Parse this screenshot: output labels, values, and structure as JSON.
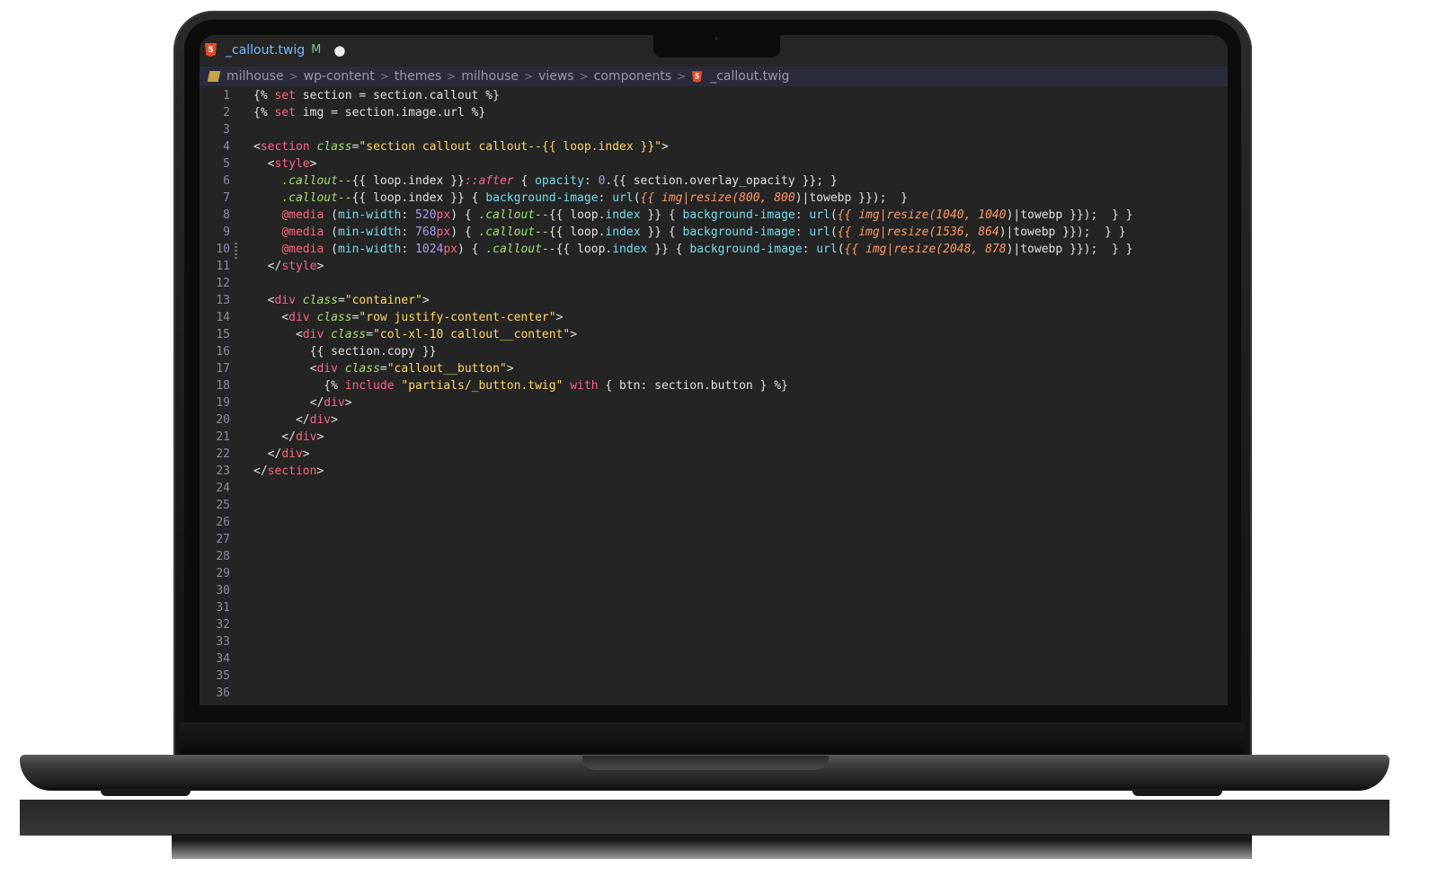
{
  "editor": {
    "tab": {
      "icon": "html5-icon",
      "filename": "_callout.twig",
      "status": "M",
      "dirty_dot": "●"
    },
    "breadcrumb": [
      "milhouse",
      "wp-content",
      "themes",
      "milhouse",
      "views",
      "components",
      "_callout.twig"
    ],
    "line_numbers": [
      "1",
      "2",
      "3",
      "4",
      "5",
      "6",
      "7",
      "8",
      "9",
      "10",
      "11",
      "12",
      "13",
      "14",
      "15",
      "16",
      "17",
      "18",
      "19",
      "20",
      "21",
      "22",
      "23",
      "24",
      "25",
      "26",
      "27",
      "28",
      "29",
      "30",
      "31",
      "32",
      "33",
      "34",
      "35",
      "36"
    ],
    "colors": {
      "background": "#242424",
      "keyword": "#ff6188",
      "string": "#ffd866",
      "attribute": "#a9dc76",
      "property": "#78dce8",
      "number": "#ab9df2",
      "italic_arg": "#fc9867"
    }
  },
  "code": {
    "l1": [
      [
        "{% ",
        "k-pun"
      ],
      [
        "set",
        "k-twig"
      ],
      [
        " section = section.callout %}",
        "k-pun"
      ]
    ],
    "l2": [
      [
        "{% ",
        "k-pun"
      ],
      [
        "set",
        "k-twig"
      ],
      [
        " img = section.image.url %}",
        "k-pun"
      ]
    ],
    "l3": [],
    "l4": [
      [
        "<",
        "k-pun"
      ],
      [
        "section",
        "k-tag"
      ],
      [
        " ",
        "k-pun"
      ],
      [
        "class",
        "k-attr"
      ],
      [
        "=",
        "k-pun"
      ],
      [
        "\"section callout callout--{{ loop.index }}\"",
        "k-str"
      ],
      [
        ">",
        "k-pun"
      ]
    ],
    "l5": [
      [
        "  <",
        "k-pun"
      ],
      [
        "style",
        "k-tag"
      ],
      [
        ">",
        "k-pun"
      ]
    ],
    "l6": [
      [
        "    ",
        "k-pun"
      ],
      [
        ".callout--",
        "k-sel"
      ],
      [
        "{{ loop.index }}",
        "k-pun"
      ],
      [
        "::after",
        "k-pseudo"
      ],
      [
        " { ",
        "k-pun"
      ],
      [
        "opacity",
        "k-prop"
      ],
      [
        ": ",
        "k-pun"
      ],
      [
        "0",
        "k-num"
      ],
      [
        ".{{ section.overlay_opacity }}; }",
        "k-pun"
      ]
    ],
    "l7": [
      [
        "    ",
        "k-pun"
      ],
      [
        ".callout--",
        "k-sel"
      ],
      [
        "{{ loop.index }} { ",
        "k-pun"
      ],
      [
        "background-image",
        "k-prop"
      ],
      [
        ": ",
        "k-pun"
      ],
      [
        "url",
        "k-prop"
      ],
      [
        "(",
        "k-pun"
      ],
      [
        "{{ img|resize(800, 800",
        "k-it"
      ],
      [
        ")|towebp }});  }",
        "k-pun"
      ]
    ],
    "l8": [
      [
        "    ",
        "k-pun"
      ],
      [
        "@media",
        "k-media"
      ],
      [
        " (",
        "k-pun"
      ],
      [
        "min-width",
        "k-prop"
      ],
      [
        ": ",
        "k-pun"
      ],
      [
        "520",
        "k-num"
      ],
      [
        "px",
        "k-media"
      ],
      [
        ") { ",
        "k-pun"
      ],
      [
        ".callout--",
        "k-sel"
      ],
      [
        "{{ loop.",
        "k-pun"
      ],
      [
        "index",
        "k-prop"
      ],
      [
        " }} { ",
        "k-pun"
      ],
      [
        "background-image",
        "k-prop"
      ],
      [
        ": ",
        "k-pun"
      ],
      [
        "url",
        "k-prop"
      ],
      [
        "(",
        "k-pun"
      ],
      [
        "{{ img|resize(1040, 1040",
        "k-it"
      ],
      [
        ")|towebp }});  } }",
        "k-pun"
      ]
    ],
    "l9": [
      [
        "    ",
        "k-pun"
      ],
      [
        "@media",
        "k-media"
      ],
      [
        " (",
        "k-pun"
      ],
      [
        "min-width",
        "k-prop"
      ],
      [
        ": ",
        "k-pun"
      ],
      [
        "768",
        "k-num"
      ],
      [
        "px",
        "k-media"
      ],
      [
        ") { ",
        "k-pun"
      ],
      [
        ".callout--",
        "k-sel"
      ],
      [
        "{{ loop.",
        "k-pun"
      ],
      [
        "index",
        "k-prop"
      ],
      [
        " }} { ",
        "k-pun"
      ],
      [
        "background-image",
        "k-prop"
      ],
      [
        ": ",
        "k-pun"
      ],
      [
        "url",
        "k-prop"
      ],
      [
        "(",
        "k-pun"
      ],
      [
        "{{ img|resize(1536, 864",
        "k-it"
      ],
      [
        ")|towebp }});  } }",
        "k-pun"
      ]
    ],
    "l10": [
      [
        "    ",
        "k-pun"
      ],
      [
        "@media",
        "k-media"
      ],
      [
        " (",
        "k-pun"
      ],
      [
        "min-width",
        "k-prop"
      ],
      [
        ": ",
        "k-pun"
      ],
      [
        "1024",
        "k-num"
      ],
      [
        "px",
        "k-media"
      ],
      [
        ") { ",
        "k-pun"
      ],
      [
        ".callout--",
        "k-sel"
      ],
      [
        "{{ loop.",
        "k-pun"
      ],
      [
        "index",
        "k-prop"
      ],
      [
        " }} { ",
        "k-pun"
      ],
      [
        "background-image",
        "k-prop"
      ],
      [
        ": ",
        "k-pun"
      ],
      [
        "url",
        "k-prop"
      ],
      [
        "(",
        "k-pun"
      ],
      [
        "{{ img|resize(2048, 878",
        "k-it"
      ],
      [
        ")|towebp }});  } }",
        "k-pun"
      ]
    ],
    "l11": [
      [
        "  </",
        "k-pun"
      ],
      [
        "style",
        "k-tag"
      ],
      [
        ">",
        "k-pun"
      ]
    ],
    "l12": [],
    "l13": [
      [
        "  <",
        "k-pun"
      ],
      [
        "div",
        "k-tag"
      ],
      [
        " ",
        "k-pun"
      ],
      [
        "class",
        "k-attr"
      ],
      [
        "=",
        "k-pun"
      ],
      [
        "\"container\"",
        "k-str"
      ],
      [
        ">",
        "k-pun"
      ]
    ],
    "l14": [
      [
        "    <",
        "k-pun"
      ],
      [
        "div",
        "k-tag"
      ],
      [
        " ",
        "k-pun"
      ],
      [
        "class",
        "k-attr"
      ],
      [
        "=",
        "k-pun"
      ],
      [
        "\"row justify-content-center\"",
        "k-str"
      ],
      [
        ">",
        "k-pun"
      ]
    ],
    "l15": [
      [
        "      <",
        "k-pun"
      ],
      [
        "div",
        "k-tag"
      ],
      [
        " ",
        "k-pun"
      ],
      [
        "class",
        "k-attr"
      ],
      [
        "=",
        "k-pun"
      ],
      [
        "\"col-xl-10 callout__content\"",
        "k-str"
      ],
      [
        ">",
        "k-pun"
      ]
    ],
    "l16": [
      [
        "        {{ section.copy }}",
        "k-pun"
      ]
    ],
    "l17": [
      [
        "        <",
        "k-pun"
      ],
      [
        "div",
        "k-tag"
      ],
      [
        " ",
        "k-pun"
      ],
      [
        "class",
        "k-attr"
      ],
      [
        "=",
        "k-pun"
      ],
      [
        "\"callout__button\"",
        "k-str"
      ],
      [
        ">",
        "k-pun"
      ]
    ],
    "l18": [
      [
        "          {% ",
        "k-pun"
      ],
      [
        "include",
        "k-kw"
      ],
      [
        " ",
        "k-pun"
      ],
      [
        "\"partials/_button.twig\"",
        "k-str"
      ],
      [
        " ",
        "k-pun"
      ],
      [
        "with",
        "k-kw"
      ],
      [
        " { btn: section.button } %}",
        "k-pun"
      ]
    ],
    "l19": [
      [
        "        </",
        "k-pun"
      ],
      [
        "div",
        "k-tag"
      ],
      [
        ">",
        "k-pun"
      ]
    ],
    "l20": [
      [
        "      </",
        "k-pun"
      ],
      [
        "div",
        "k-tag"
      ],
      [
        ">",
        "k-pun"
      ]
    ],
    "l21": [
      [
        "    </",
        "k-pun"
      ],
      [
        "div",
        "k-tag"
      ],
      [
        ">",
        "k-pun"
      ]
    ],
    "l22": [
      [
        "  </",
        "k-pun"
      ],
      [
        "div",
        "k-tag"
      ],
      [
        ">",
        "k-pun"
      ]
    ],
    "l23": [
      [
        "</",
        "k-pun"
      ],
      [
        "section",
        "k-tag"
      ],
      [
        ">",
        "k-pun"
      ]
    ]
  }
}
